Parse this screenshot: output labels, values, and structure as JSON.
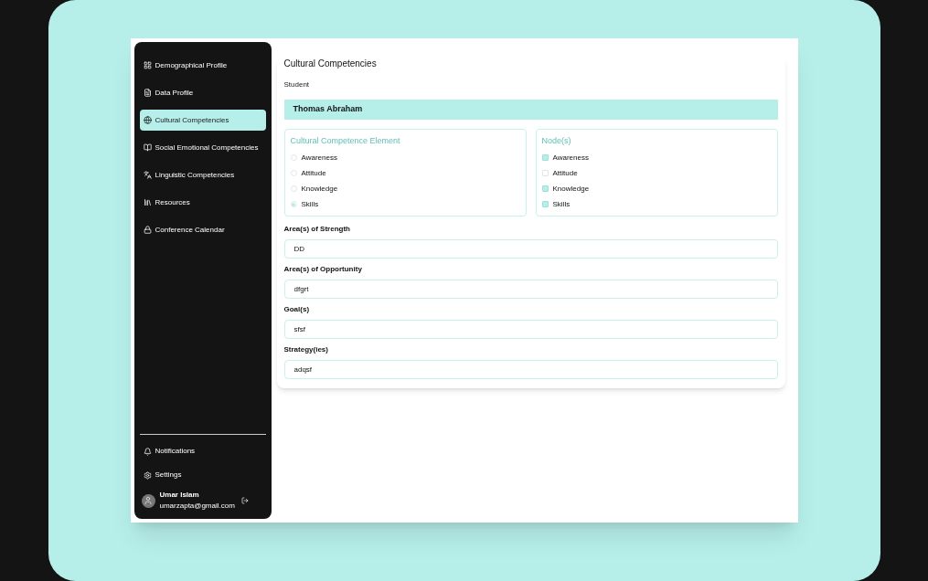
{
  "sidebar": {
    "items": [
      {
        "label": "Demographical Profile",
        "selected": false
      },
      {
        "label": "Data Profile",
        "selected": false
      },
      {
        "label": "Cultural Competencies",
        "selected": true
      },
      {
        "label": "Social Emotional Competencies",
        "selected": false
      },
      {
        "label": "Linguistic Competencies",
        "selected": false
      },
      {
        "label": "Resources",
        "selected": false
      },
      {
        "label": "Conference Calendar",
        "selected": false
      }
    ],
    "bottom_items": [
      {
        "label": "Notifications"
      },
      {
        "label": "Settings"
      }
    ],
    "user": {
      "name": "Umar Islam",
      "email": "umarzapta@gmail.com"
    }
  },
  "page": {
    "title": "Cultural Competencies",
    "subtitle": "Student",
    "student_name": "Thomas Abraham",
    "element_group": {
      "title": "Cultural Competence Element",
      "options": [
        {
          "label": "Awareness",
          "selected": false
        },
        {
          "label": "Attitude",
          "selected": false
        },
        {
          "label": "Knowledge",
          "selected": false
        },
        {
          "label": "Skills",
          "selected": true
        }
      ]
    },
    "nodes_group": {
      "title": "Node(s)",
      "options": [
        {
          "label": "Awareness",
          "checked": true
        },
        {
          "label": "Attitude",
          "checked": false
        },
        {
          "label": "Knowledge",
          "checked": true
        },
        {
          "label": "Skills",
          "checked": true
        }
      ]
    },
    "fields": [
      {
        "label": "Area(s) of Strength",
        "value": "DD"
      },
      {
        "label": "Area(s) of Opportunity",
        "value": "dfgrt"
      },
      {
        "label": "Goal(s)",
        "value": "sfsf"
      },
      {
        "label": "Strategy(ies)",
        "value": "adqsf"
      }
    ]
  }
}
